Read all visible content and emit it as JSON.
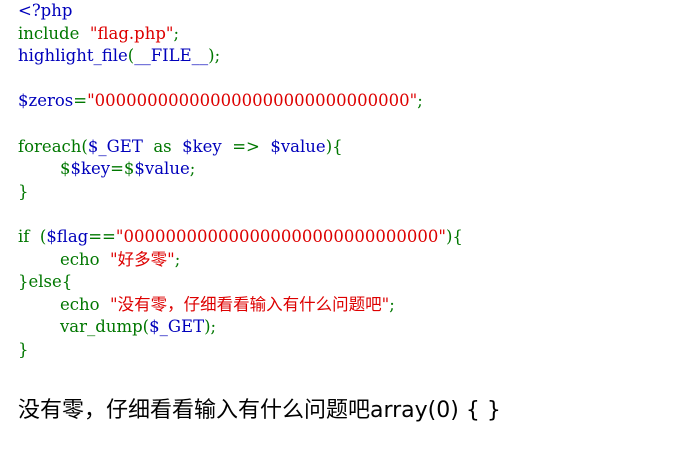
{
  "code_lines": [
    [
      {
        "t": "<?php",
        "c": "html"
      }
    ],
    [
      {
        "t": "include",
        "c": "keyword"
      },
      {
        "t": "  ",
        "c": "default"
      },
      {
        "t": "\"flag.php\"",
        "c": "string"
      },
      {
        "t": ";",
        "c": "keyword"
      }
    ],
    [
      {
        "t": "highlight_file",
        "c": "default"
      },
      {
        "t": "(",
        "c": "keyword"
      },
      {
        "t": "__FILE__",
        "c": "default"
      },
      {
        "t": ");",
        "c": "keyword"
      }
    ],
    [],
    [
      {
        "t": "$zeros",
        "c": "default"
      },
      {
        "t": "=",
        "c": "keyword"
      },
      {
        "t": "\"000000000000000000000000000000\"",
        "c": "string"
      },
      {
        "t": ";",
        "c": "keyword"
      }
    ],
    [],
    [
      {
        "t": "foreach(",
        "c": "keyword"
      },
      {
        "t": "$_GET",
        "c": "default"
      },
      {
        "t": "  as  ",
        "c": "keyword"
      },
      {
        "t": "$key",
        "c": "default"
      },
      {
        "t": "  =>  ",
        "c": "keyword"
      },
      {
        "t": "$value",
        "c": "default"
      },
      {
        "t": "){",
        "c": "keyword"
      }
    ],
    [
      {
        "t": "        $",
        "c": "keyword"
      },
      {
        "t": "$key",
        "c": "default"
      },
      {
        "t": "=$",
        "c": "keyword"
      },
      {
        "t": "$value",
        "c": "default"
      },
      {
        "t": ";",
        "c": "keyword"
      }
    ],
    [
      {
        "t": "}",
        "c": "keyword"
      }
    ],
    [],
    [
      {
        "t": "if  (",
        "c": "keyword"
      },
      {
        "t": "$flag",
        "c": "default"
      },
      {
        "t": "==",
        "c": "keyword"
      },
      {
        "t": "\"000000000000000000000000000000\"",
        "c": "string"
      },
      {
        "t": "){",
        "c": "keyword"
      }
    ],
    [
      {
        "t": "        echo  ",
        "c": "keyword"
      },
      {
        "t": "\"好多零\"",
        "c": "string"
      },
      {
        "t": ";",
        "c": "keyword"
      }
    ],
    [
      {
        "t": "}else{",
        "c": "keyword"
      }
    ],
    [
      {
        "t": "        echo  ",
        "c": "keyword"
      },
      {
        "t": "\"没有零，仔细看看输入有什么问题吧\"",
        "c": "string"
      },
      {
        "t": ";",
        "c": "keyword"
      }
    ],
    [
      {
        "t": "        var_dump",
        "c": "keyword"
      },
      {
        "t": "(",
        "c": "keyword"
      },
      {
        "t": "$_GET",
        "c": "default"
      },
      {
        "t": ");",
        "c": "keyword"
      }
    ],
    [
      {
        "t": "}",
        "c": "keyword"
      }
    ]
  ],
  "output_text": "没有零，仔细看看输入有什么问题吧array(0) { }",
  "colors": {
    "html": "#0000bb",
    "default": "#0000bb",
    "keyword": "#007700",
    "string": "#dd0000"
  }
}
